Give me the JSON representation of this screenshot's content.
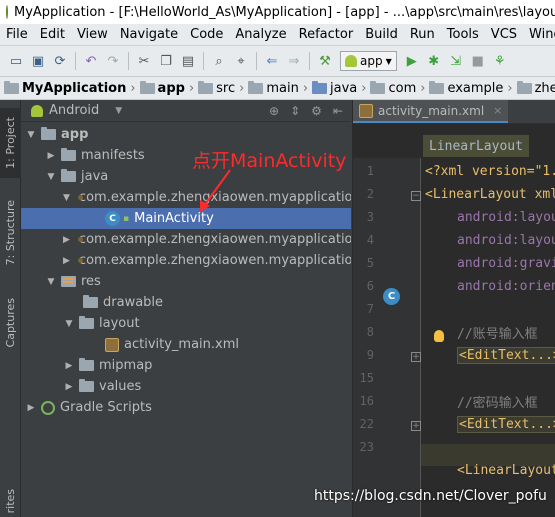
{
  "window": {
    "title": "MyApplication - [F:\\HelloWorld_As\\MyApplication] - [app] - ...\\app\\src\\main\\res\\layout\\activ"
  },
  "menu": [
    "File",
    "Edit",
    "View",
    "Navigate",
    "Code",
    "Analyze",
    "Refactor",
    "Build",
    "Run",
    "Tools",
    "VCS",
    "Window"
  ],
  "toolbar": {
    "run_config": "app",
    "icons": [
      "open-icon",
      "save-icon",
      "sync-icon",
      "undo-icon",
      "redo-icon",
      "cut-icon",
      "copy-icon",
      "paste-icon",
      "find-icon",
      "replace-icon",
      "back-icon",
      "forward-icon",
      "build-icon",
      "run-icon",
      "debug-icon",
      "attach-icon",
      "stop-icon",
      "profile-icon"
    ]
  },
  "breadcrumbs": [
    "MyApplication",
    "app",
    "src",
    "main",
    "java",
    "com",
    "example",
    "zhengxi"
  ],
  "left_strip": {
    "project_tab": "1: Project",
    "structure_tab": "7: Structure",
    "captures_tab": "Captures",
    "favorites_tab": "rites"
  },
  "project_panel": {
    "view_mode": "Android",
    "tree": [
      {
        "label": "app",
        "depth": 0,
        "expanded": true,
        "icon": "folder-icon",
        "bold": true
      },
      {
        "label": "manifests",
        "depth": 1,
        "expanded": false,
        "icon": "folder-icon"
      },
      {
        "label": "java",
        "depth": 1,
        "expanded": true,
        "icon": "folder-icon"
      },
      {
        "label": "com.example.zhengxiaowen.myapplication",
        "depth": 2,
        "expanded": true,
        "icon": "package-icon"
      },
      {
        "label": "MainActivity",
        "depth": 3,
        "expanded": null,
        "icon": "class-icon",
        "selected": true
      },
      {
        "label": "com.example.zhengxiaowen.myapplication",
        "depth": 2,
        "expanded": false,
        "icon": "package-icon"
      },
      {
        "label": "com.example.zhengxiaowen.myapplication",
        "depth": 2,
        "expanded": false,
        "icon": "package-icon"
      },
      {
        "label": "res",
        "depth": 1,
        "expanded": true,
        "icon": "res-folder-icon"
      },
      {
        "label": "drawable",
        "depth": 2,
        "expanded": null,
        "icon": "folder-icon"
      },
      {
        "label": "layout",
        "depth": 2,
        "expanded": true,
        "icon": "folder-icon"
      },
      {
        "label": "activity_main.xml",
        "depth": 3,
        "expanded": null,
        "icon": "xml-file-icon"
      },
      {
        "label": "mipmap",
        "depth": 2,
        "expanded": false,
        "icon": "folder-icon"
      },
      {
        "label": "values",
        "depth": 2,
        "expanded": false,
        "icon": "folder-icon"
      },
      {
        "label": "Gradle Scripts",
        "depth": 0,
        "expanded": false,
        "icon": "gradle-icon"
      }
    ],
    "annotation": "点开MainActivity"
  },
  "editor": {
    "tab_label": "activity_main.xml",
    "breadcrumb": "LinearLayout",
    "line_numbers": [
      "1",
      "2",
      "3",
      "4",
      "5",
      "6",
      "7",
      "8",
      "9",
      "15",
      "16",
      "22",
      "23"
    ],
    "lines": [
      {
        "num": "1",
        "text": "<?xml version=\"1."
      },
      {
        "num": "2",
        "text": "<LinearLayout xml"
      },
      {
        "num": "3",
        "text": "android:layou"
      },
      {
        "num": "4",
        "text": "android:layou"
      },
      {
        "num": "5",
        "text": "android:gravi"
      },
      {
        "num": "6",
        "text": "android:orien"
      },
      {
        "num": "7",
        "text": ""
      },
      {
        "num": "8",
        "text": "//账号输入框"
      },
      {
        "num": "9",
        "text": "<EditText...>"
      },
      {
        "num": "15",
        "text": ""
      },
      {
        "num": "16",
        "text": "//密码输入框"
      },
      {
        "num": "22",
        "text": "<EditText...>"
      },
      {
        "num": "23",
        "text": "<LinearLayout"
      }
    ]
  },
  "watermark": "https://blog.csdn.net/Clover_pofu"
}
